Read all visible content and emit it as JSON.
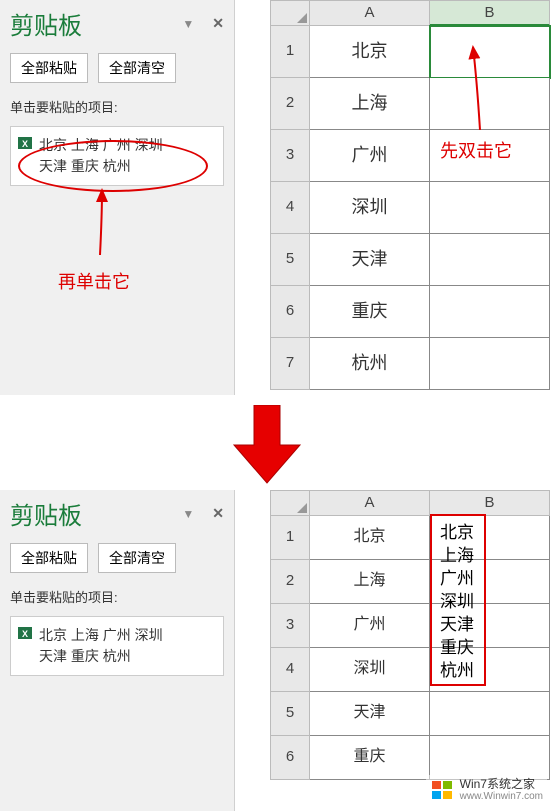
{
  "clipboard": {
    "title": "剪贴板",
    "paste_all_label": "全部粘贴",
    "clear_all_label": "全部清空",
    "items_label": "单击要粘贴的项目:",
    "item_line1": "北京 上海 广州 深圳",
    "item_line2": "天津 重庆 杭州"
  },
  "sheet_top": {
    "col_a": "A",
    "col_b": "B",
    "rows": [
      {
        "num": "1",
        "a": "北京",
        "b": ""
      },
      {
        "num": "2",
        "a": "上海",
        "b": ""
      },
      {
        "num": "3",
        "a": "广州",
        "b": ""
      },
      {
        "num": "4",
        "a": "深圳",
        "b": ""
      },
      {
        "num": "5",
        "a": "天津",
        "b": ""
      },
      {
        "num": "6",
        "a": "重庆",
        "b": ""
      },
      {
        "num": "7",
        "a": "杭州",
        "b": ""
      }
    ]
  },
  "sheet_bottom": {
    "col_a": "A",
    "col_b": "B",
    "rows": [
      {
        "num": "1",
        "a": "北京"
      },
      {
        "num": "2",
        "a": "上海"
      },
      {
        "num": "3",
        "a": "广州"
      },
      {
        "num": "4",
        "a": "深圳"
      },
      {
        "num": "5",
        "a": "天津"
      },
      {
        "num": "6",
        "a": "重庆"
      }
    ],
    "b1_content": "北京\n上海\n广州\n深圳\n天津\n重庆\n杭州"
  },
  "annotations": {
    "double_click": "先双击它",
    "single_click": "再单击它"
  },
  "watermark": {
    "title": "Win7系统之家",
    "url": "www.Winwin7.com"
  },
  "chart_data": {
    "type": "table",
    "description": "Excel tutorial: converting clipboard space-separated items into column via double-click then single-click paste",
    "source_items": [
      "北京",
      "上海",
      "广州",
      "深圳",
      "天津",
      "重庆",
      "杭州"
    ],
    "column_a": [
      "北京",
      "上海",
      "广州",
      "深圳",
      "天津",
      "重庆",
      "杭州"
    ],
    "result_b1_multiline": [
      "北京",
      "上海",
      "广州",
      "深圳",
      "天津",
      "重庆",
      "杭州"
    ]
  }
}
